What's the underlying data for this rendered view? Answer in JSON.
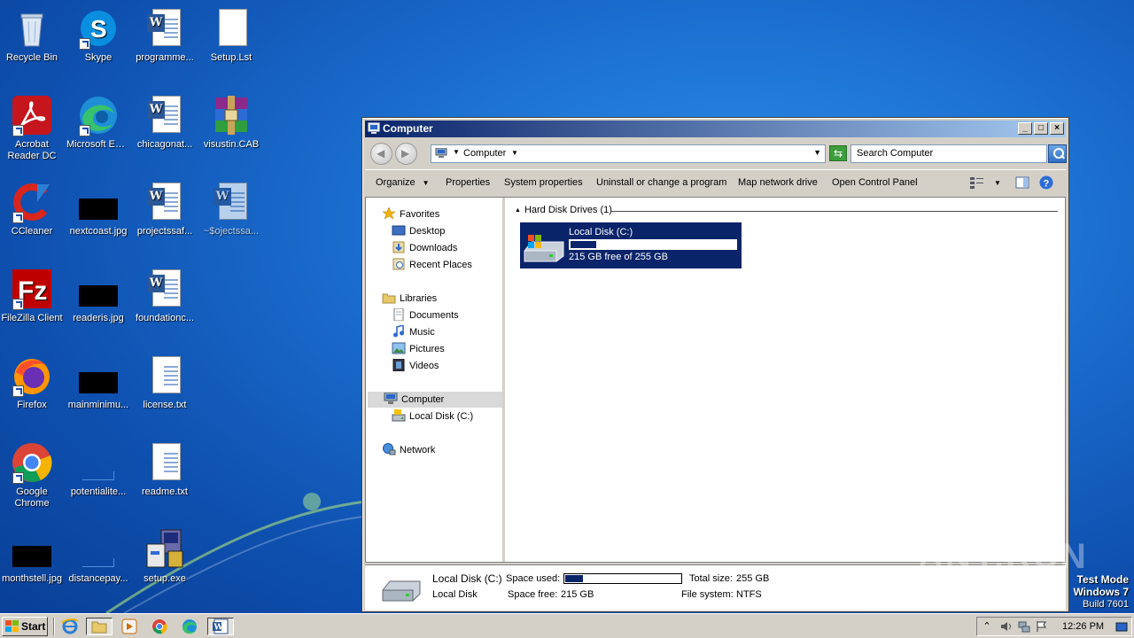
{
  "desktop": {
    "icons": [
      {
        "label": "Recycle Bin",
        "icon": "recycle-bin-icon"
      },
      {
        "label": "Skype",
        "icon": "skype-icon"
      },
      {
        "label": "programme...",
        "icon": "word-document-icon"
      },
      {
        "label": "Setup.Lst",
        "icon": "text-file-icon"
      },
      {
        "label": "Acrobat Reader DC",
        "icon": "acrobat-icon"
      },
      {
        "label": "Microsoft Edge",
        "icon": "edge-icon"
      },
      {
        "label": "chicagonat...",
        "icon": "word-document-icon"
      },
      {
        "label": "visustin.CAB",
        "icon": "winrar-archive-icon"
      },
      {
        "label": "CCleaner",
        "icon": "ccleaner-icon"
      },
      {
        "label": "nextcoast.jpg",
        "icon": "image-thumbnail-icon"
      },
      {
        "label": "projectssaf...",
        "icon": "word-document-icon"
      },
      {
        "label": "~$ojectssa...",
        "icon": "word-temp-document-icon"
      },
      {
        "label": "FileZilla Client",
        "icon": "filezilla-icon"
      },
      {
        "label": "readeris.jpg",
        "icon": "image-thumbnail-icon"
      },
      {
        "label": "foundationc...",
        "icon": "word-document-icon"
      },
      {
        "label": "Firefox",
        "icon": "firefox-icon"
      },
      {
        "label": "mainminimu...",
        "icon": "image-thumbnail-icon"
      },
      {
        "label": "license.txt",
        "icon": "text-file-icon"
      },
      {
        "label": "Google Chrome",
        "icon": "chrome-icon"
      },
      {
        "label": "potentialite...",
        "icon": "image-thumbnail-icon"
      },
      {
        "label": "readme.txt",
        "icon": "text-file-icon"
      },
      {
        "label": "monthstell.jpg",
        "icon": "image-thumbnail-icon"
      },
      {
        "label": "distancepay...",
        "icon": "image-thumbnail-icon"
      },
      {
        "label": "setup.exe",
        "icon": "installer-icon"
      }
    ]
  },
  "window": {
    "title": "Computer",
    "address": {
      "crumb": "Computer"
    },
    "search_placeholder": "Search Computer",
    "toolbar": {
      "organize": "Organize",
      "system_properties": "System properties",
      "properties": "Properties",
      "uninstall": "Uninstall or change a program",
      "map_drive": "Map network drive",
      "control_panel": "Open Control Panel"
    },
    "nav": {
      "favorites": "Favorites",
      "desktop": "Desktop",
      "downloads": "Downloads",
      "recent": "Recent Places",
      "libraries": "Libraries",
      "documents": "Documents",
      "music": "Music",
      "pictures": "Pictures",
      "videos": "Videos",
      "computer": "Computer",
      "local_disk": "Local Disk (C:)",
      "network": "Network"
    },
    "group_header": "Hard Disk Drives (1)",
    "drive": {
      "name": "Local Disk (C:)",
      "free_text": "215 GB free of 255 GB",
      "used_fraction": 0.157
    },
    "details": {
      "name": "Local Disk (C:)",
      "type": "Local Disk",
      "space_used_label": "Space used:",
      "space_free_label": "Space free:",
      "space_free_value": "215 GB",
      "total_size_label": "Total size:",
      "total_size_value": "255 GB",
      "file_system_label": "File system:",
      "file_system_value": "NTFS",
      "used_fraction": 0.157
    }
  },
  "watermark": "ANY.RUN",
  "test_mode": {
    "line1": "Test Mode",
    "line2": "Windows 7",
    "line3": "Build 7601"
  },
  "taskbar": {
    "start_label": "Start",
    "clock": "12:26 PM"
  },
  "colors": {
    "title_gradient_start": "#0a246a",
    "title_gradient_end": "#a6caf0",
    "selection": "#0a246a",
    "desktop_blue": "#1b6fd0",
    "chrome": "#d4d0c8"
  }
}
